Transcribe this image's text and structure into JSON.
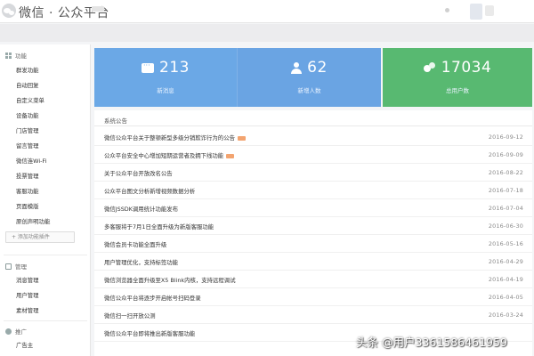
{
  "header": {
    "brand": "微信 · 公众平台"
  },
  "sidebar": {
    "sections": [
      {
        "label": "功能",
        "icon": "grid-icon"
      },
      {
        "label": "管理",
        "icon": "briefcase-icon"
      },
      {
        "label": "推广",
        "icon": "user-icon"
      }
    ],
    "feature_items": [
      "群发功能",
      "自动回复",
      "自定义菜单",
      "设备功能",
      "门店管理",
      "留言管理",
      "微信连Wi-Fi",
      "投票管理",
      "客服功能",
      "页面模版",
      "原创声明功能"
    ],
    "add_plugin": "+ 添加功能插件",
    "manage_items": [
      "消息管理",
      "用户管理",
      "素材管理"
    ],
    "promo_items": [
      "广告主"
    ]
  },
  "stats": [
    {
      "value": "213",
      "label": "新消息",
      "icon": "message-icon",
      "color": "#6ba8e6"
    },
    {
      "value": "62",
      "label": "新增人数",
      "icon": "person-icon",
      "color": "#6aa4e3"
    },
    {
      "value": "17034",
      "label": "总用户数",
      "icon": "group-icon",
      "color": "#58b971"
    }
  ],
  "notices": {
    "title": "系统公告",
    "items": [
      {
        "text": "微信公众平台关于整顿新型多级分销欺诈行为的公告",
        "date": "2016-09-12",
        "new": true
      },
      {
        "text": "公众平台安全中心增加短期运营者及拥下线功能",
        "date": "2016-09-09",
        "new": true
      },
      {
        "text": "关于公众平台开放改名公告",
        "date": "2016-08-22",
        "new": false
      },
      {
        "text": "公众平台图文分析新增视频数据分析",
        "date": "2016-07-18",
        "new": false
      },
      {
        "text": "微信JSSDK调用统计功能发布",
        "date": "2016-07-04",
        "new": false
      },
      {
        "text": "多客服将于7月1日全面升级为新版客服功能",
        "date": "2016-06-30",
        "new": false
      },
      {
        "text": "微信会员卡功能全面升级",
        "date": "2016-05-16",
        "new": false
      },
      {
        "text": "用户管理优化，支持标签功能",
        "date": "2016-04-29",
        "new": false
      },
      {
        "text": "微信浏览器全面升级至X5 Blink内核，支持远程调试",
        "date": "2016-04-19",
        "new": false
      },
      {
        "text": "微信公众平台将逐步开启帐号扫码登录",
        "date": "2016-04-05",
        "new": false
      },
      {
        "text": "微信扫一扫开放公测",
        "date": "2016-03-24",
        "new": false
      },
      {
        "text": "微信公众平台即将推出新版客服功能",
        "date": "",
        "new": false
      }
    ]
  },
  "watermark": "头条 @用户3361586461959"
}
